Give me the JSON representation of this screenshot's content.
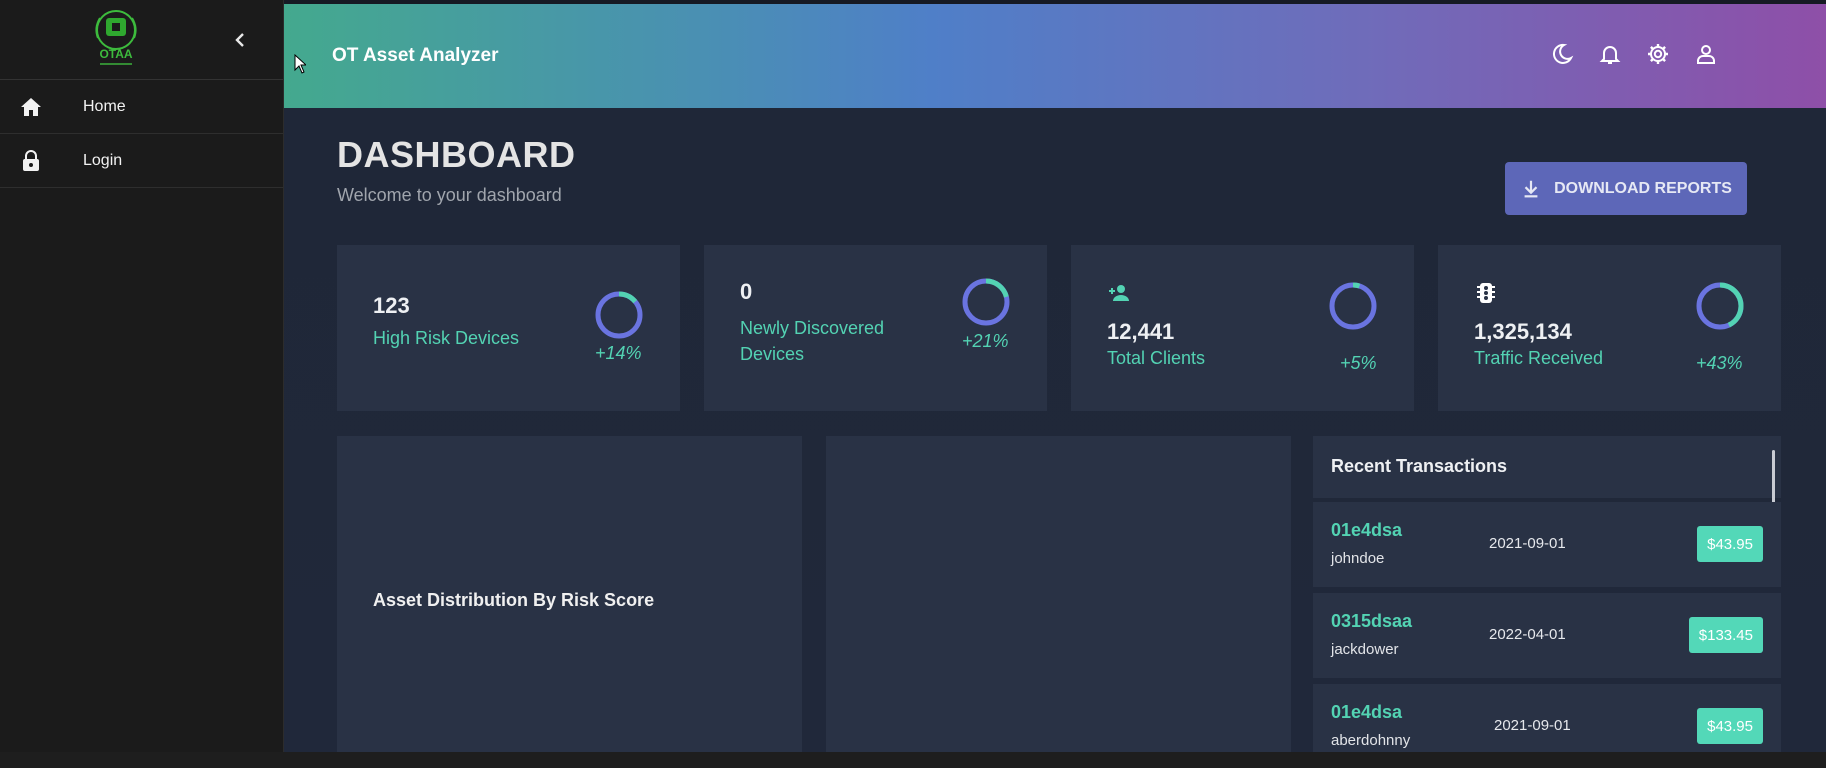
{
  "header": {
    "app_title": "OT Asset Analyzer"
  },
  "logo": {
    "text": "OTAA"
  },
  "sidebar": {
    "items": [
      {
        "label": "Home",
        "icon": "home-icon"
      },
      {
        "label": "Login",
        "icon": "lock-icon"
      }
    ]
  },
  "dashboard": {
    "title": "DASHBOARD",
    "subtitle": "Welcome to your dashboard",
    "download_label": "DOWNLOAD REPORTS"
  },
  "stats": [
    {
      "value": "123",
      "label": "High Risk Devices",
      "pct": "+14%",
      "progress": 0.14
    },
    {
      "value": "0",
      "label": "Newly Discovered Devices",
      "pct": "+21%",
      "progress": 0.21
    },
    {
      "value": "12,441",
      "label": "Total Clients",
      "pct": "+5%",
      "progress": 0.05,
      "icon": "person-add-icon"
    },
    {
      "value": "1,325,134",
      "label": "Traffic Received",
      "pct": "+43%",
      "progress": 0.43,
      "icon": "traffic-icon"
    }
  ],
  "panels": {
    "asset_title": "Asset Distribution By Risk Score"
  },
  "transactions": {
    "title": "Recent Transactions",
    "rows": [
      {
        "id": "01e4dsa",
        "user": "johndoe",
        "date": "2021-09-01",
        "amount": "$43.95"
      },
      {
        "id": "0315dsaa",
        "user": "jackdower",
        "date": "2022-04-01",
        "amount": "$133.45"
      },
      {
        "id": "01e4dsa",
        "user": "aberdohnny",
        "date": "2021-09-01",
        "amount": "$43.95"
      }
    ]
  },
  "colors": {
    "accent": "#53d3b3",
    "ring": "#6a74e0",
    "button": "#5d67b8",
    "card": "#293245"
  }
}
